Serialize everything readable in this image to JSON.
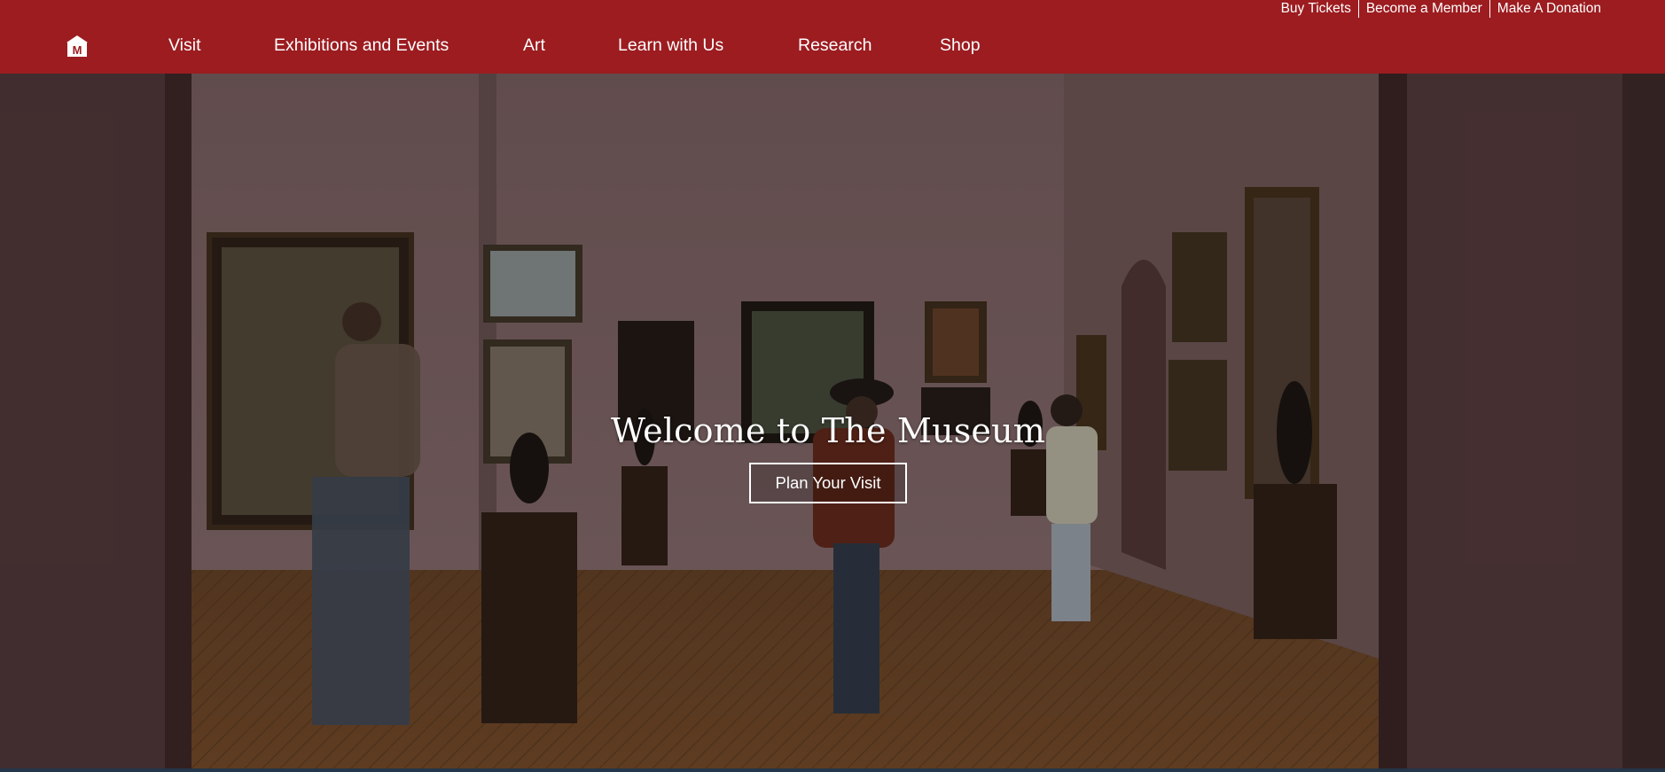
{
  "utility_nav": {
    "buy_tickets": "Buy Tickets",
    "become_member": "Become a Member",
    "make_donation": "Make A Donation"
  },
  "logo": {
    "letter": "M",
    "icon": "museum-home-icon"
  },
  "nav": {
    "visit": "Visit",
    "exhibitions": "Exhibitions and Events",
    "art": "Art",
    "learn": "Learn with Us",
    "research": "Research",
    "shop": "Shop"
  },
  "hero": {
    "title": "Welcome to The Museum",
    "cta": "Plan Your Visit",
    "image": "gallery-interior-photo"
  },
  "colors": {
    "brand_red": "#9c1c20",
    "text_white": "#ffffff"
  }
}
